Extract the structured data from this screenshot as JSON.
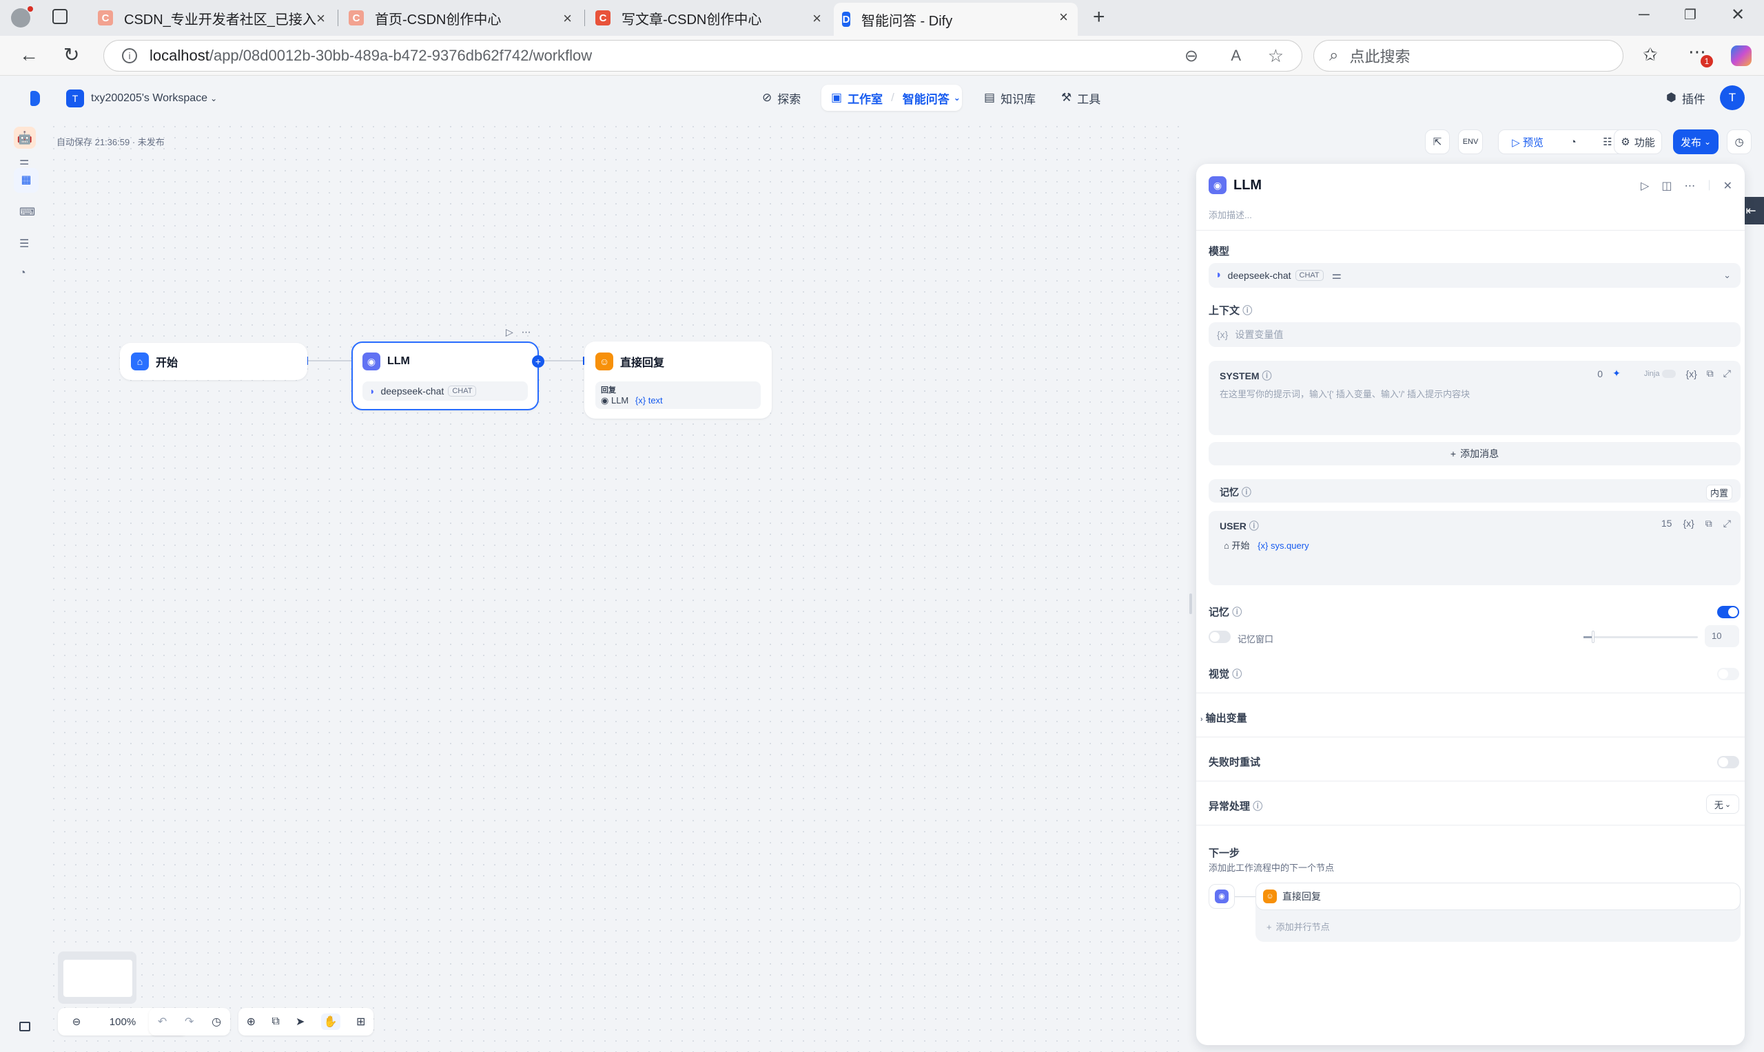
{
  "browser": {
    "tabs": [
      {
        "label": "CSDN_专业开发者社区_已接入De",
        "favicon": "C"
      },
      {
        "label": "首页-CSDN创作中心",
        "favicon": "C"
      },
      {
        "label": "写文章-CSDN创作中心",
        "favicon": "C"
      },
      {
        "label": "智能问答 - Dify",
        "favicon": "D"
      }
    ],
    "url_host": "localhost",
    "url_path": "/app/08d0012b-30bb-489a-b472-9376db62f742/workflow",
    "search_placeholder": "点此搜索",
    "notification_count": "1"
  },
  "app": {
    "workspace_initial": "T",
    "workspace_name": "txy200205's Workspace",
    "nav": {
      "explore": "探索",
      "studio": "工作室",
      "app_name": "智能问答",
      "knowledge": "知识库",
      "tools": "工具"
    },
    "plugins": "插件",
    "avatar": "T",
    "autosave": "自动保存 21:36:59 · 未发布",
    "toolbar": {
      "preview": "预览",
      "features": "功能",
      "publish": "发布"
    },
    "zoom": "100%"
  },
  "nodes": {
    "start": {
      "title": "开始"
    },
    "llm": {
      "title": "LLM",
      "model": "deepseek-chat",
      "tag": "CHAT"
    },
    "answer": {
      "title": "直接回复",
      "sub_label": "回复",
      "ref_node": "LLM",
      "ref_var": "text"
    }
  },
  "panel": {
    "title": "LLM",
    "description_placeholder": "添加描述...",
    "model_label": "模型",
    "model_name": "deepseek-chat",
    "model_tag": "CHAT",
    "context_label": "上下文",
    "context_placeholder": "设置变量值",
    "system_label": "SYSTEM",
    "system_count": "0",
    "jinja": "Jinja",
    "system_placeholder": "在这里写你的提示词，输入'{' 插入变量、输入'/' 插入提示内容块",
    "add_message": "添加消息",
    "memory_row_label": "记忆",
    "memory_builtin": "内置",
    "user_label": "USER",
    "user_count": "15",
    "user_ref_node": "开始",
    "user_ref_var": "sys.query",
    "memory_label": "记忆",
    "memory_window_label": "记忆窗口",
    "memory_window_value": "10",
    "vision_label": "视觉",
    "output_vars": "输出变量",
    "retry_label": "失败时重试",
    "error_label": "异常处理",
    "error_value": "无",
    "next_step_label": "下一步",
    "next_step_desc": "添加此工作流程中的下一个节点",
    "next_node": "直接回复",
    "add_parallel": "添加并行节点"
  },
  "colors": {
    "accent": "#155aef",
    "start_icon": "#2970ff",
    "llm_icon": "#6172f3",
    "answer_icon": "#f79009"
  }
}
